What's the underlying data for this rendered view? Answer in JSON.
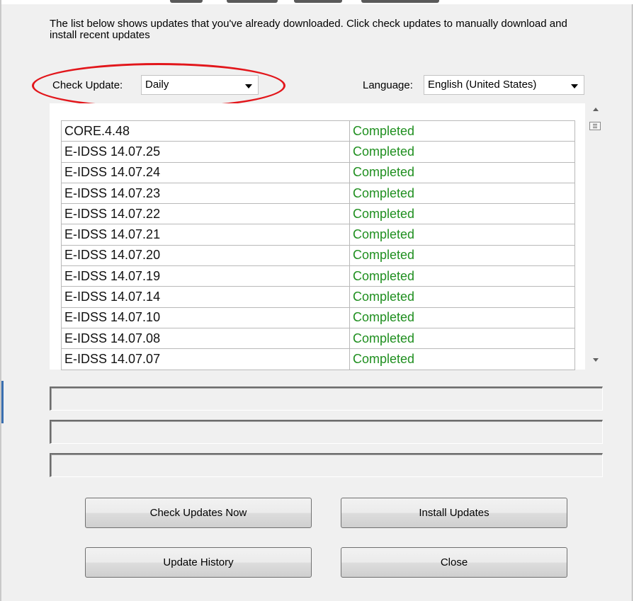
{
  "description": "The list below shows updates that you've already downloaded.  Click check updates to manually download and install recent updates",
  "check_update": {
    "label": "Check Update:",
    "selected": "Daily"
  },
  "language": {
    "label": "Language:",
    "selected": "English (United States)"
  },
  "updates": [
    {
      "name": "CORE.4.48",
      "status": "Completed"
    },
    {
      "name": "E-IDSS 14.07.25",
      "status": "Completed"
    },
    {
      "name": "E-IDSS 14.07.24",
      "status": "Completed"
    },
    {
      "name": "E-IDSS 14.07.23",
      "status": "Completed"
    },
    {
      "name": "E-IDSS 14.07.22",
      "status": "Completed"
    },
    {
      "name": "E-IDSS 14.07.21",
      "status": "Completed"
    },
    {
      "name": "E-IDSS 14.07.20",
      "status": "Completed"
    },
    {
      "name": "E-IDSS 14.07.19",
      "status": "Completed"
    },
    {
      "name": "E-IDSS 14.07.14",
      "status": "Completed"
    },
    {
      "name": "E-IDSS 14.07.10",
      "status": "Completed"
    },
    {
      "name": "E-IDSS 14.07.08",
      "status": "Completed"
    },
    {
      "name": "E-IDSS 14.07.07",
      "status": "Completed"
    }
  ],
  "status_fields": [
    "",
    "",
    ""
  ],
  "buttons": {
    "check_updates_now": "Check Updates Now",
    "install_updates": "Install Updates",
    "update_history": "Update History",
    "close": "Close"
  },
  "colors": {
    "status_completed": "#1f8f1f",
    "highlight_ellipse": "#e2161b",
    "window_bg": "#f0f0f0"
  }
}
